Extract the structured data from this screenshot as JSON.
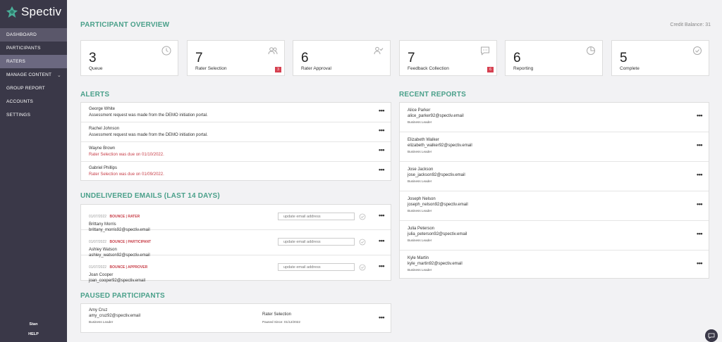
{
  "app": {
    "name": "Spectiv",
    "user": "Stan",
    "help": "HELP"
  },
  "sidebar": {
    "items": [
      {
        "label": "DASHBOARD"
      },
      {
        "label": "PARTICIPANTS"
      },
      {
        "label": "RATERS"
      },
      {
        "label": "MANAGE CONTENT"
      },
      {
        "label": "GROUP REPORT"
      },
      {
        "label": "ACCOUNTS"
      },
      {
        "label": "SETTINGS"
      }
    ]
  },
  "overview": {
    "title": "PARTICIPANT OVERVIEW",
    "credit": "Credit Balance: 31",
    "cards": [
      {
        "value": "3",
        "label": "Queue",
        "icon": "clock-icon",
        "badge": ""
      },
      {
        "value": "7",
        "label": "Rater Selection",
        "icon": "users-icon",
        "badge": "3"
      },
      {
        "value": "6",
        "label": "Rater Approval",
        "icon": "user-check-icon",
        "badge": ""
      },
      {
        "value": "7",
        "label": "Feedback Collection",
        "icon": "chat-icon",
        "badge": "6"
      },
      {
        "value": "6",
        "label": "Reporting",
        "icon": "pie-chart-icon",
        "badge": ""
      },
      {
        "value": "5",
        "label": "Complete",
        "icon": "check-circle-icon",
        "badge": ""
      }
    ]
  },
  "alerts": {
    "title": "ALERTS",
    "items": [
      {
        "name": "George White",
        "message": "Assessment request was made from the DEMO initiation portal."
      },
      {
        "name": "Rachel Johnson",
        "message": "Assessment request was made from the DEMO initiation portal."
      },
      {
        "name": "Wayne Brown",
        "message": "Rater Selection was due on 01/10/2022."
      },
      {
        "name": "Gabriel Phillips",
        "message": "Rater Selection was due on 01/09/2022."
      }
    ]
  },
  "emails": {
    "title": "UNDELIVERED EMAILS (LAST 14 DAYS)",
    "placeholder": "update email address",
    "items": [
      {
        "date": "01/07/2022",
        "type": "BOUNCE | RATER",
        "name": "Brittany Morris",
        "email": "brittany_morris92@spectiv.email"
      },
      {
        "date": "01/07/2022",
        "type": "BOUNCE | PARTICIPANT",
        "name": "Ashley Watson",
        "email": "ashley_watson92@spectiv.email"
      },
      {
        "date": "01/07/2022",
        "type": "BOUNCE | APPROVER",
        "name": "Joan Cooper",
        "email": "joan_cooper92@spectiv.email"
      }
    ]
  },
  "paused": {
    "title": "PAUSED PARTICIPANTS",
    "items": [
      {
        "name": "Amy Cruz",
        "email": "amy_cruz92@spectiv.email",
        "role": "Business Leader",
        "stage": "Rater Selection",
        "since": "Paused Since: 01/12/2022"
      }
    ]
  },
  "reports": {
    "title": "RECENT REPORTS",
    "items": [
      {
        "name": "Alice Parker",
        "email": "alice_parker92@spectiv.email",
        "role": "Business Leader"
      },
      {
        "name": "Elizabeth Walker",
        "email": "elizabeth_walker92@spectiv.email",
        "role": "Business Leader"
      },
      {
        "name": "Jose Jackson",
        "email": "jose_jackson92@spectiv.email",
        "role": "Business Leader"
      },
      {
        "name": "Joseph Nelson",
        "email": "joseph_nelson92@spectiv.email",
        "role": "Business Leader"
      },
      {
        "name": "Julia Peterson",
        "email": "julia_peterson92@spectiv.email",
        "role": "Business Leader"
      },
      {
        "name": "Kyle Martin",
        "email": "kyle_martin92@spectiv.email",
        "role": "Business Leader"
      }
    ]
  },
  "more_label": "•••"
}
